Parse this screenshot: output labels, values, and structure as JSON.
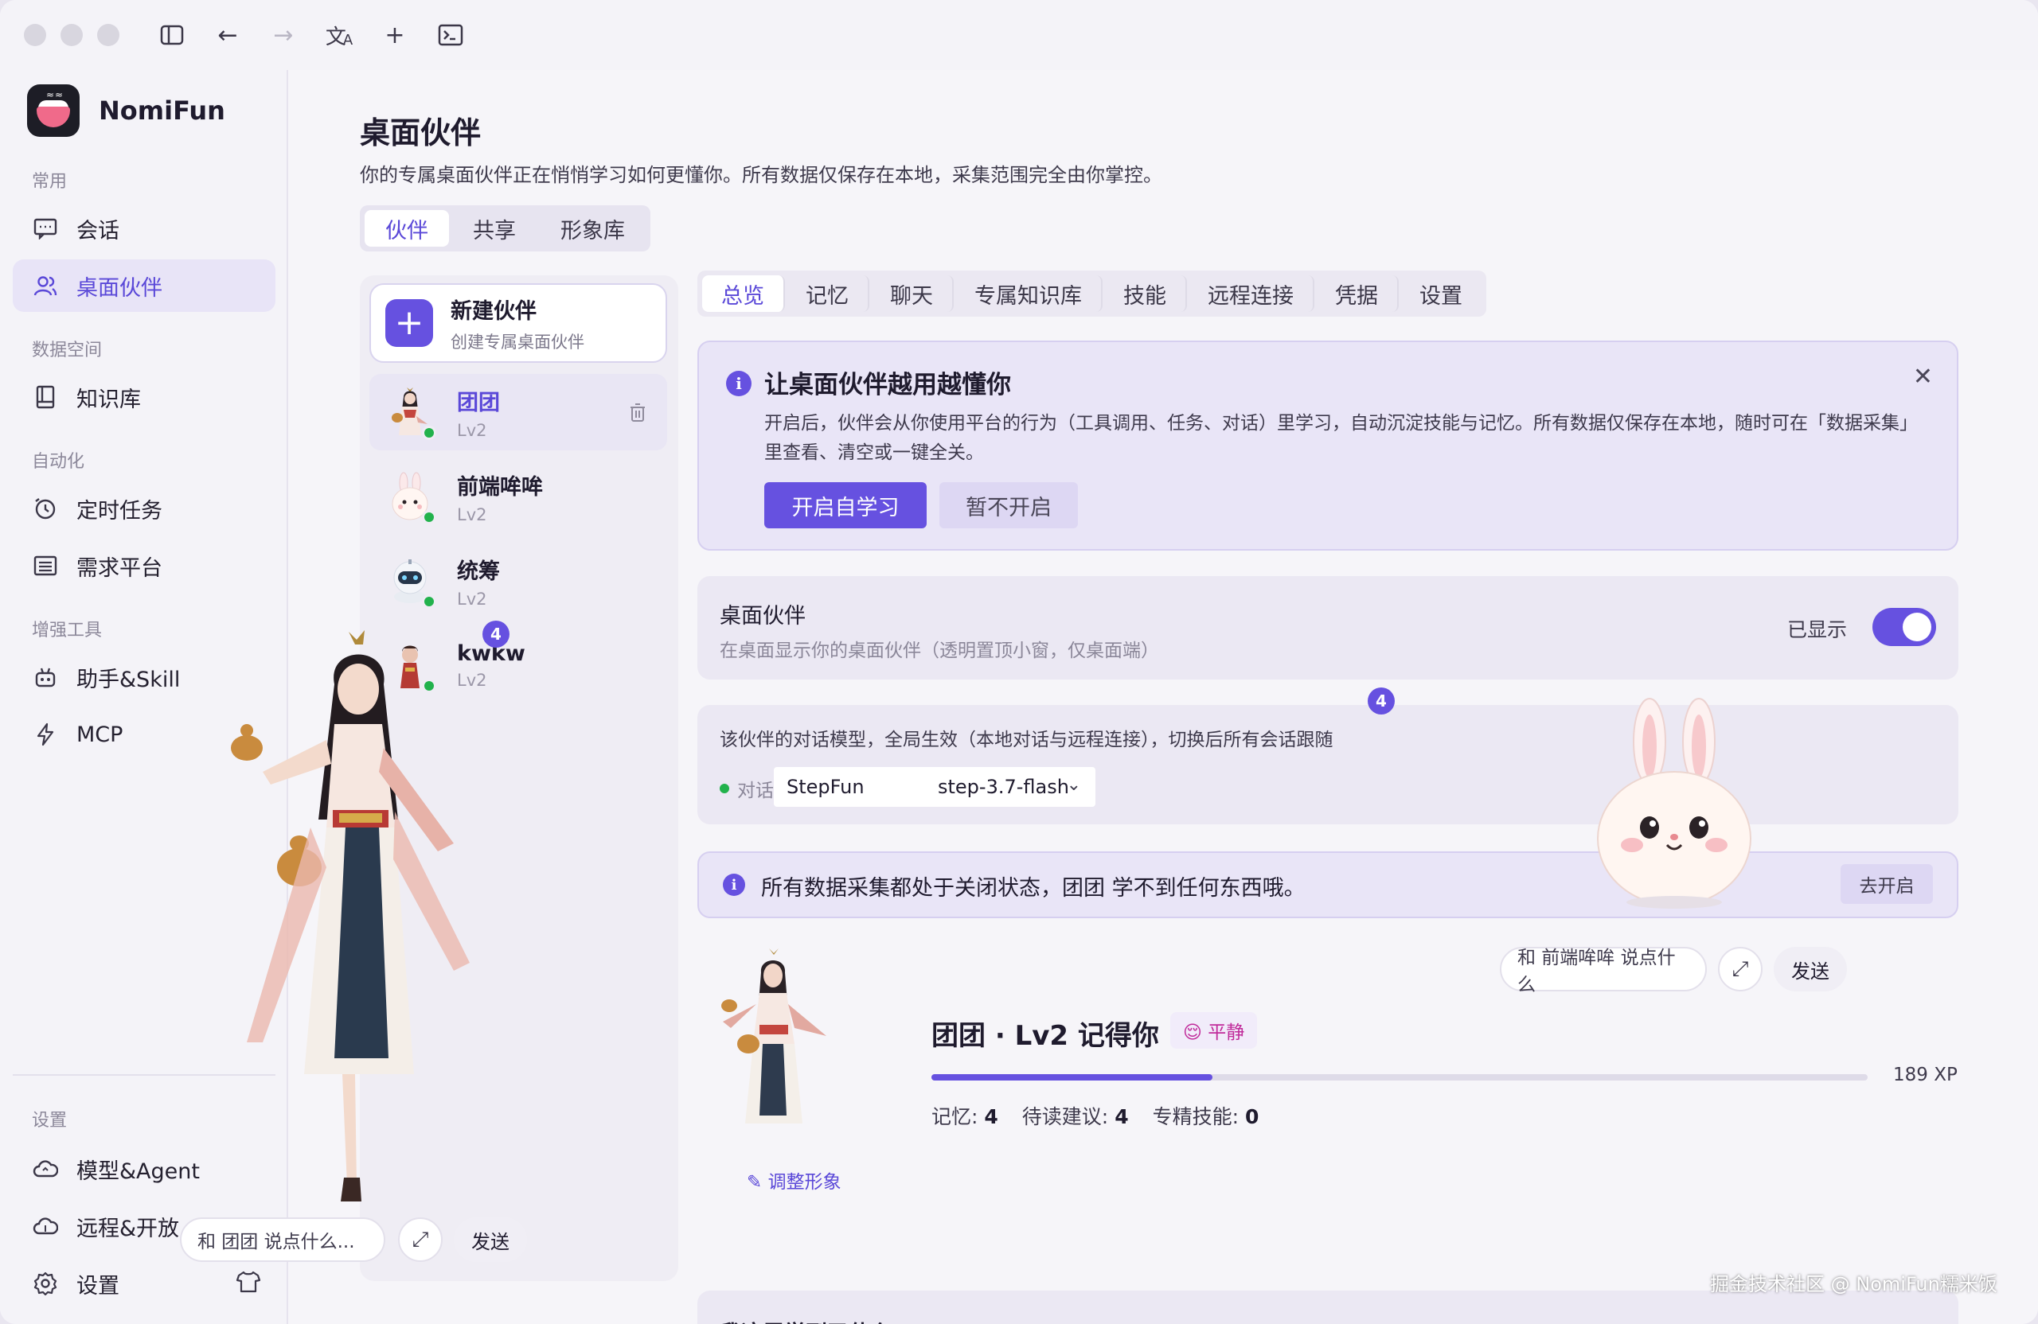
{
  "app": {
    "name": "NomiFun"
  },
  "sidebar": {
    "sections": {
      "common": "常用",
      "data": "数据空间",
      "automation": "自动化",
      "tools": "增强工具",
      "settings": "设置"
    },
    "items": [
      {
        "label": "会话",
        "icon": "chat-icon"
      },
      {
        "label": "桌面伙伴",
        "icon": "users-icon",
        "active": true
      },
      {
        "label": "知识库",
        "icon": "book-icon"
      },
      {
        "label": "定时任务",
        "icon": "clock-icon"
      },
      {
        "label": "需求平台",
        "icon": "list-icon"
      },
      {
        "label": "助手&Skill",
        "icon": "robot-icon"
      },
      {
        "label": "MCP",
        "icon": "bolt-icon"
      },
      {
        "label": "模型&Agent",
        "icon": "cloud-icon"
      },
      {
        "label": "远程&开放",
        "icon": "cloud-up-icon"
      },
      {
        "label": "设置",
        "icon": "gear-icon"
      }
    ]
  },
  "page": {
    "title": "桌面伙伴",
    "subtitle": "你的专属桌面伙伴正在悄悄学习如何更懂你。所有数据仅保存在本地，采集范围完全由你掌控。",
    "seg_tabs": [
      "伙伴",
      "共享",
      "形象库"
    ],
    "active_seg": "伙伴"
  },
  "partners": {
    "new_title": "新建伙伴",
    "new_sub": "创建专属桌面伙伴",
    "items": [
      {
        "name": "团团",
        "level": "Lv2",
        "selected": true
      },
      {
        "name": "前端哞哞",
        "level": "Lv2"
      },
      {
        "name": "统筹",
        "level": "Lv2"
      },
      {
        "name": "kwkw",
        "level": "Lv2",
        "badge": "4"
      }
    ]
  },
  "detail_tabs": [
    "总览",
    "记忆",
    "聊天",
    "专属知识库",
    "技能",
    "远程连接",
    "凭据",
    "设置"
  ],
  "tip": {
    "title": "让桌面伙伴越用越懂你",
    "body": "开启后，伙伴会从你使用平台的行为（工具调用、任务、对话）里学习，自动沉淀技能与记忆。所有数据仅保存在本地，随时可在「数据采集」里查看、清空或一键全关。",
    "primary": "开启自学习",
    "secondary": "暂不开启"
  },
  "desktop": {
    "title": "桌面伙伴",
    "desc": "在桌面显示你的桌面伙伴（透明置顶小窗，仅桌面端）",
    "status": "已显示",
    "enabled": true
  },
  "model": {
    "desc": "该伙伴的对话模型，全局生效（本地对话与远程连接），切换后所有会话跟随",
    "label": "对话模型",
    "provider": "StepFun",
    "model": "step-3.7-flash",
    "badge": "4"
  },
  "warning": {
    "text": "所有数据采集都处于关闭状态，团团 学不到任何东西哦。",
    "action": "去开启"
  },
  "chat": {
    "placeholder_right": "和 前端哞哞 说点什么",
    "placeholder_left": "和 团团 说点什么...",
    "send": "发送"
  },
  "profile": {
    "title": "团团 · Lv2 记得你",
    "mood": "😌 平静",
    "xp": "189 XP",
    "xp_progress": 0.3,
    "stats": [
      {
        "label": "记忆:",
        "value": "4"
      },
      {
        "label": "待读建议:",
        "value": "4"
      },
      {
        "label": "专精技能:",
        "value": "0"
      }
    ],
    "adjust": "调整形象"
  },
  "learn": {
    "title": "我这周学到了什么"
  },
  "watermark": "掘金技术社区 @ NomiFun糯米饭",
  "colors": {
    "accent": "#6651e0",
    "online": "#22b24c"
  }
}
